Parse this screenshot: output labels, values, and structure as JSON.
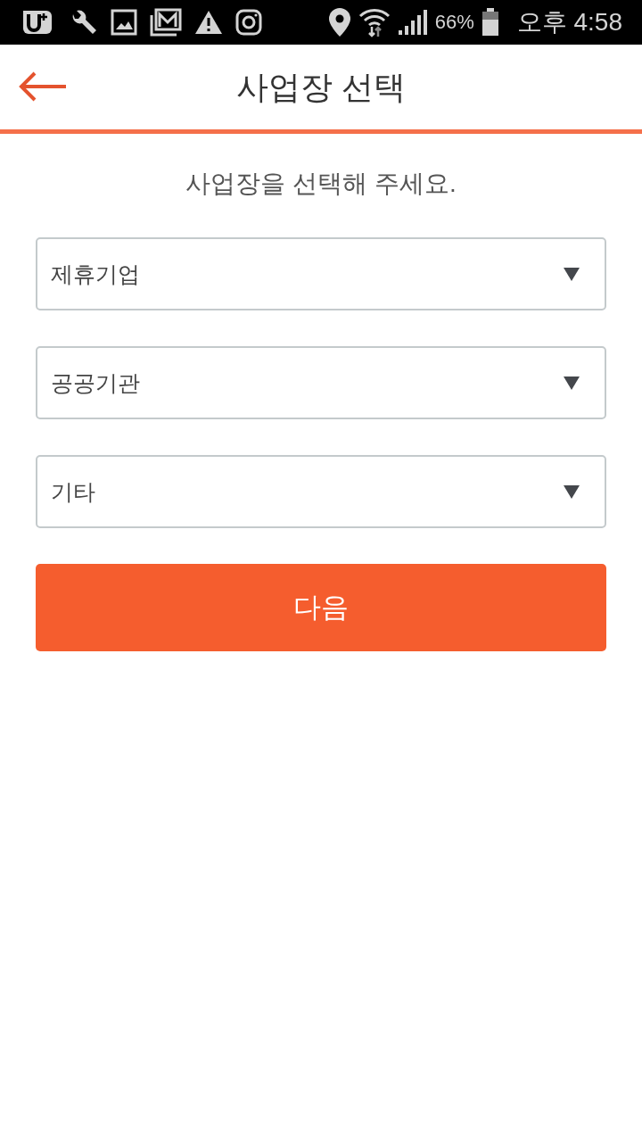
{
  "status_bar": {
    "battery_percent": "66%",
    "time": "오후 4:58"
  },
  "header": {
    "title": "사업장 선택"
  },
  "prompt": "사업장을 선택해 주세요.",
  "dropdowns": [
    {
      "label": "제휴기업"
    },
    {
      "label": "공공기관"
    },
    {
      "label": "기타"
    }
  ],
  "next_button": {
    "label": "다음"
  }
}
